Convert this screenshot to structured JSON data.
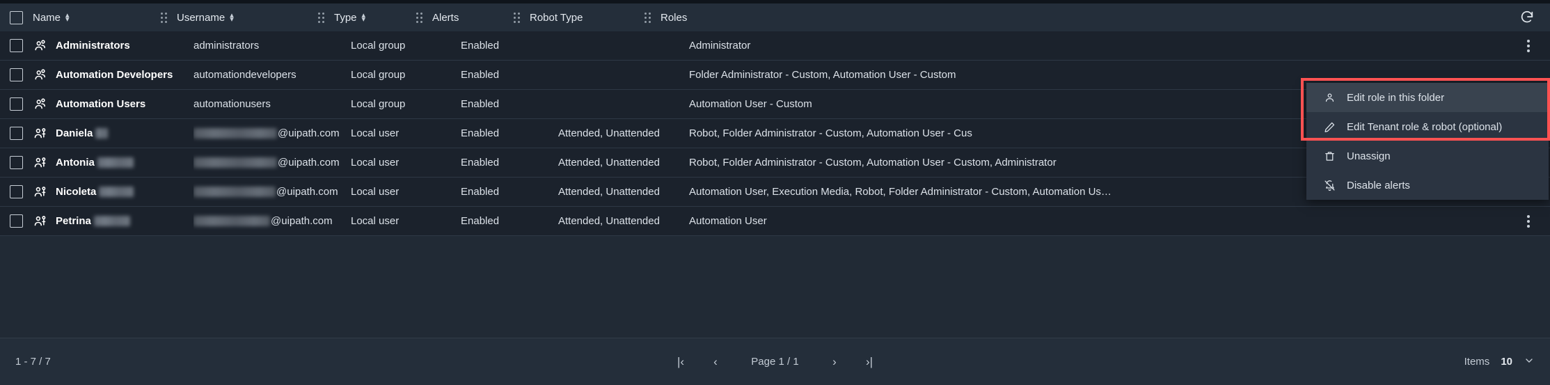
{
  "header": {
    "select_all_checkbox": "unchecked",
    "refresh_label": "Refresh",
    "columns": [
      {
        "label": "Name",
        "sortable": true,
        "grip": false
      },
      {
        "label": "Username",
        "sortable": true,
        "grip": true
      },
      {
        "label": "Type",
        "sortable": true,
        "grip": true
      },
      {
        "label": "Alerts",
        "sortable": false,
        "grip": true
      },
      {
        "label": "Robot Type",
        "sortable": false,
        "grip": true
      },
      {
        "label": "Roles",
        "sortable": false,
        "grip": true
      }
    ]
  },
  "rows": [
    {
      "name": "Administrators",
      "name_redacted": false,
      "entity": "group",
      "username": "administrators",
      "username_redacted": false,
      "type": "Local group",
      "alerts": "Enabled",
      "robot_type": "",
      "roles": "Administrator"
    },
    {
      "name": "Automation Developers",
      "name_redacted": false,
      "entity": "group",
      "username": "automationdevelopers",
      "username_redacted": false,
      "type": "Local group",
      "alerts": "Enabled",
      "robot_type": "",
      "roles": "Folder Administrator - Custom, Automation User - Custom"
    },
    {
      "name": "Automation Users",
      "name_redacted": false,
      "entity": "group",
      "username": "automationusers",
      "username_redacted": false,
      "type": "Local group",
      "alerts": "Enabled",
      "robot_type": "",
      "roles": "Automation User - Custom"
    },
    {
      "name": "Daniela",
      "name_redacted": true,
      "redact_name_width": 18,
      "entity": "user",
      "username": "@uipath.com",
      "username_redacted": true,
      "redact_user_width": 120,
      "type": "Local user",
      "alerts": "Enabled",
      "robot_type": "Attended, Unattended",
      "roles": "Robot, Folder Administrator - Custom, Automation User - Cus"
    },
    {
      "name": "Antonia",
      "name_redacted": true,
      "redact_name_width": 52,
      "entity": "user",
      "username": "@uipath.com",
      "username_redacted": true,
      "redact_user_width": 120,
      "type": "Local user",
      "alerts": "Enabled",
      "robot_type": "Attended, Unattended",
      "roles": "Robot, Folder Administrator - Custom, Automation User - Custom, Administrator"
    },
    {
      "name": "Nicoleta",
      "name_redacted": true,
      "redact_name_width": 50,
      "entity": "user",
      "username": "@uipath.com",
      "username_redacted": true,
      "redact_user_width": 118,
      "type": "Local user",
      "alerts": "Enabled",
      "robot_type": "Attended, Unattended",
      "roles": "Automation User, Execution Media, Robot, Folder Administrator - Custom, Automation Us…"
    },
    {
      "name": "Petrina",
      "name_redacted": true,
      "redact_name_width": 52,
      "entity": "user",
      "username": "@uipath.com",
      "username_redacted": true,
      "redact_user_width": 110,
      "type": "Local user",
      "alerts": "Enabled",
      "robot_type": "Attended, Unattended",
      "roles": "Automation User"
    }
  ],
  "context_menu": {
    "highlight_color": "#ff5252",
    "items": [
      {
        "label": "Edit role in this folder",
        "icon": "person-icon",
        "highlighted": true
      },
      {
        "label": "Edit Tenant role & robot (optional)",
        "icon": "pencil-icon",
        "highlighted": false
      },
      {
        "label": "Unassign",
        "icon": "trash-icon",
        "highlighted": false
      },
      {
        "label": "Disable alerts",
        "icon": "bell-off-icon",
        "highlighted": false
      }
    ]
  },
  "footer": {
    "range": "1 - 7 / 7",
    "first_page": "|‹",
    "prev_page": "‹",
    "page_label": "Page 1 / 1",
    "next_page": "›",
    "last_page": "›|",
    "items_label": "Items",
    "items_value": "10"
  }
}
